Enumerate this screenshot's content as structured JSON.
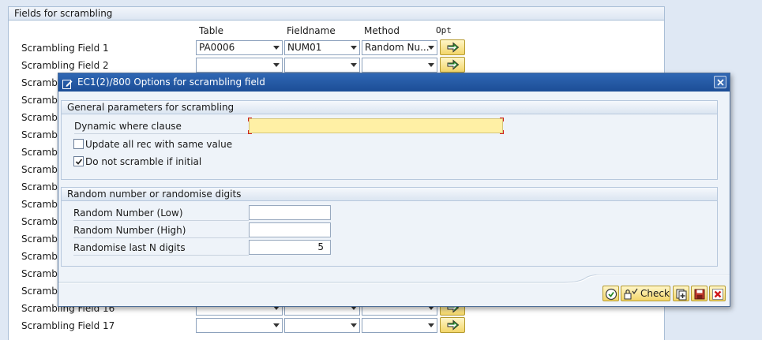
{
  "background": {
    "panel_title": "Fields for scrambling",
    "columns": {
      "table": "Table",
      "fieldname": "Fieldname",
      "method": "Method",
      "opt": "Opt"
    },
    "rows": [
      {
        "label": "Scrambling Field 1",
        "table": "PA0006",
        "fieldname": "NUM01",
        "method": "Random Nu..."
      },
      {
        "label": "Scrambling Field 2",
        "table": "",
        "fieldname": "",
        "method": ""
      },
      {
        "label": "Scrambli",
        "table": "",
        "fieldname": "",
        "method": ""
      },
      {
        "label": "Scrambli",
        "table": "",
        "fieldname": "",
        "method": ""
      },
      {
        "label": "Scrambli",
        "table": "",
        "fieldname": "",
        "method": ""
      },
      {
        "label": "Scrambli",
        "table": "",
        "fieldname": "",
        "method": ""
      },
      {
        "label": "Scrambli",
        "table": "",
        "fieldname": "",
        "method": ""
      },
      {
        "label": "Scrambli",
        "table": "",
        "fieldname": "",
        "method": ""
      },
      {
        "label": "Scrambli",
        "table": "",
        "fieldname": "",
        "method": ""
      },
      {
        "label": "Scrambli",
        "table": "",
        "fieldname": "",
        "method": ""
      },
      {
        "label": "Scrambli",
        "table": "",
        "fieldname": "",
        "method": ""
      },
      {
        "label": "Scrambli",
        "table": "",
        "fieldname": "",
        "method": ""
      },
      {
        "label": "Scrambli",
        "table": "",
        "fieldname": "",
        "method": ""
      },
      {
        "label": "Scrambli",
        "table": "",
        "fieldname": "",
        "method": ""
      },
      {
        "label": "Scrambli",
        "table": "",
        "fieldname": "",
        "method": ""
      },
      {
        "label": "Scrambling Field 16",
        "table": "",
        "fieldname": "",
        "method": ""
      },
      {
        "label": "Scrambling Field 17",
        "table": "",
        "fieldname": "",
        "method": ""
      }
    ]
  },
  "dialog": {
    "title": "EC1(2)/800 Options for scrambling field",
    "general": {
      "title": "General parameters for scrambling",
      "dynamic_where_label": "Dynamic where clause",
      "dynamic_where_value": "",
      "update_all_label": "Update all rec with same value",
      "update_all_checked": false,
      "no_scramble_initial_label": "Do not scramble if initial",
      "no_scramble_initial_checked": true
    },
    "random": {
      "title": "Random number or randomise digits",
      "low_label": "Random Number (Low)",
      "low_value": "",
      "high_label": "Random Number (High)",
      "high_value": "",
      "last_n_label": "Randomise last N digits",
      "last_n_value": "5"
    },
    "footer": {
      "check_label": "Check"
    }
  },
  "colors": {
    "titlebar": "#1c4d96",
    "required_field": "#fff0a5",
    "button_face": "#f3d66a"
  },
  "icons": {
    "dialog": "dialog-edit-icon",
    "close": "close-icon",
    "opt": "arrow-right-icon",
    "execute": "execute-icon",
    "check": "check-icon",
    "new": "new-entries-icon",
    "save": "save-icon",
    "cancel": "cancel-icon"
  }
}
